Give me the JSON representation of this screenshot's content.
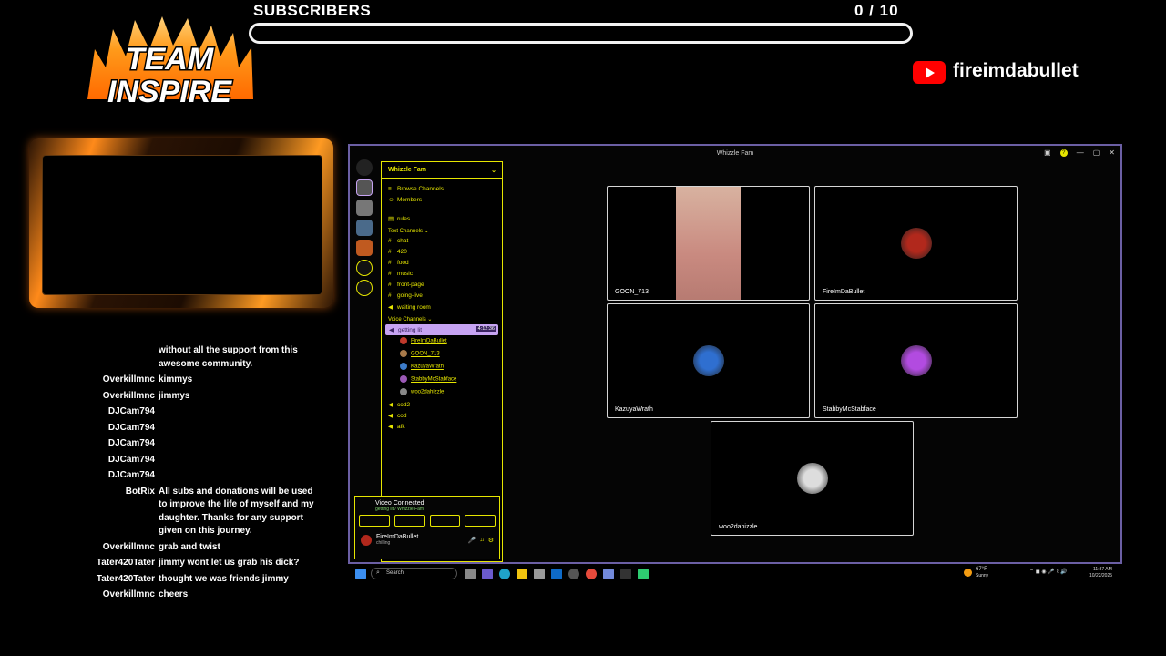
{
  "overlay": {
    "logo_text_1": "TEAM",
    "logo_text_2": "INSPIRE",
    "subscribers_label": "SUBSCRIBERS",
    "subscribers_count": "0  / 10",
    "subscribers_progress": 0,
    "youtube_channel": "fireimdabullet"
  },
  "chat": [
    {
      "user": "",
      "msg": "without all the support from this awesome community."
    },
    {
      "user": "Overkillmnc",
      "msg": "kimmys"
    },
    {
      "user": "Overkillmnc",
      "msg": "jimmys"
    },
    {
      "user": "DJCam794",
      "msg": ""
    },
    {
      "user": "DJCam794",
      "msg": ""
    },
    {
      "user": "DJCam794",
      "msg": ""
    },
    {
      "user": "DJCam794",
      "msg": ""
    },
    {
      "user": "DJCam794",
      "msg": ""
    },
    {
      "user": "BotRix",
      "msg": "All subs and donations will be used to improve the life of myself and my daughter. Thanks for any support given on this journey."
    },
    {
      "user": "Overkillmnc",
      "msg": "grab and twist"
    },
    {
      "user": "Tater420Tater",
      "msg": "jimmy wont let us grab his dick?"
    },
    {
      "user": "Tater420Tater",
      "msg": "thought we was friends jimmy"
    },
    {
      "user": "Overkillmnc",
      "msg": "cheers"
    }
  ],
  "discord": {
    "window_title": "Whizzle Fam",
    "server_name": "Whizzle Fam",
    "nav": [
      {
        "label": "Browse Channels"
      },
      {
        "label": "Members"
      },
      {
        "label": "rules"
      }
    ],
    "text_category": "Text Channels",
    "text_channels": [
      "chat",
      "420",
      "food",
      "music",
      "front-page",
      "going-live",
      "waiting room"
    ],
    "voice_category": "Voice Channels",
    "active_voice": {
      "name": "getting lit",
      "timer": "4:12:36"
    },
    "voice_members": [
      {
        "name": "FireImDaBullet",
        "color": "#c0392b"
      },
      {
        "name": "GOON_713",
        "color": "#a97a4a"
      },
      {
        "name": "KazuyaWrath",
        "color": "#3d7cc9"
      },
      {
        "name": "StabbyMcStabface",
        "color": "#9b59b6"
      },
      {
        "name": "woo2dahizzle",
        "color": "#888888"
      }
    ],
    "more_voice": [
      "cod2",
      "cod",
      "afk"
    ],
    "voice_panel": {
      "status": "Video Connected",
      "sub": "getting lit / Whizzle Fam",
      "user": "FireImDaBullet",
      "user_status": "chilling"
    },
    "tiles": [
      {
        "name": "GOON_713",
        "type": "video"
      },
      {
        "name": "FireImDaBullet",
        "type": "avatar",
        "color": "#b1281c"
      },
      {
        "name": "KazuyaWrath",
        "type": "avatar",
        "color": "#2f6fd0"
      },
      {
        "name": "StabbyMcStabface",
        "type": "avatar",
        "color": "#b24be0"
      },
      {
        "name": "woo2dahizzle",
        "type": "avatar",
        "color": "#dddddd"
      }
    ]
  },
  "taskbar": {
    "search": "Search",
    "weather": "67°F",
    "weather_desc": "Sunny",
    "time": "11:37 AM",
    "date": "10/22/2025"
  }
}
